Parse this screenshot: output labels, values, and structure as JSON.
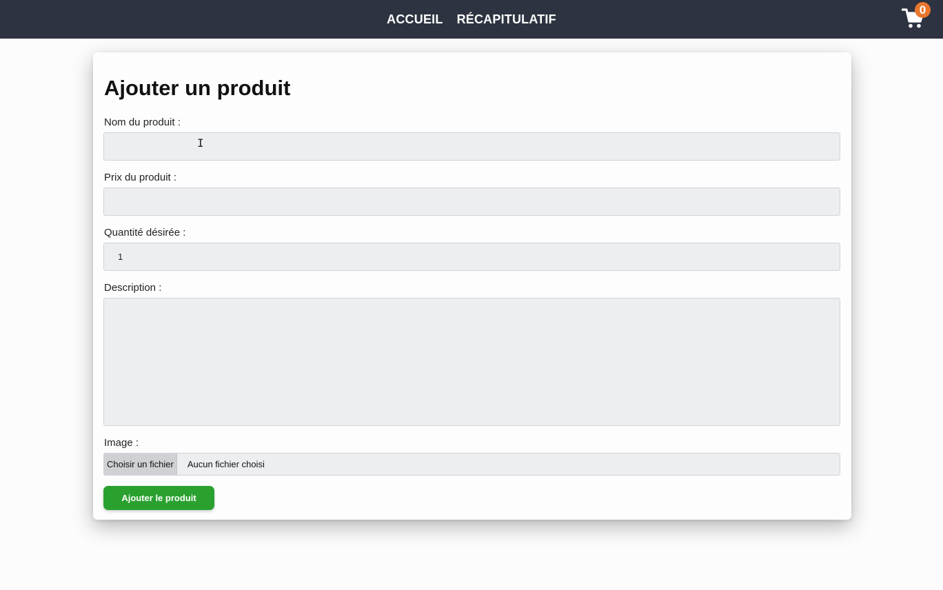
{
  "nav": {
    "items": [
      {
        "label": "ACCUEIL"
      },
      {
        "label": "RÉCAPITULATIF"
      }
    ],
    "cart": {
      "icon": "cart-icon",
      "count": "0",
      "badge_color": "#e8772e"
    }
  },
  "form": {
    "title": "Ajouter un produit",
    "name": {
      "label": "Nom du produit :",
      "value": ""
    },
    "price": {
      "label": "Prix du produit :",
      "value": ""
    },
    "quantity": {
      "label": "Quantité désirée :",
      "value": "1"
    },
    "description": {
      "label": "Description :",
      "value": ""
    },
    "image": {
      "label": "Image :",
      "button": "Choisir un fichier",
      "status": "Aucun fichier choisi"
    },
    "submit_label": "Ajouter le produit",
    "submit_color": "#2aa12f"
  },
  "colors": {
    "topbar": "#2d3340"
  }
}
